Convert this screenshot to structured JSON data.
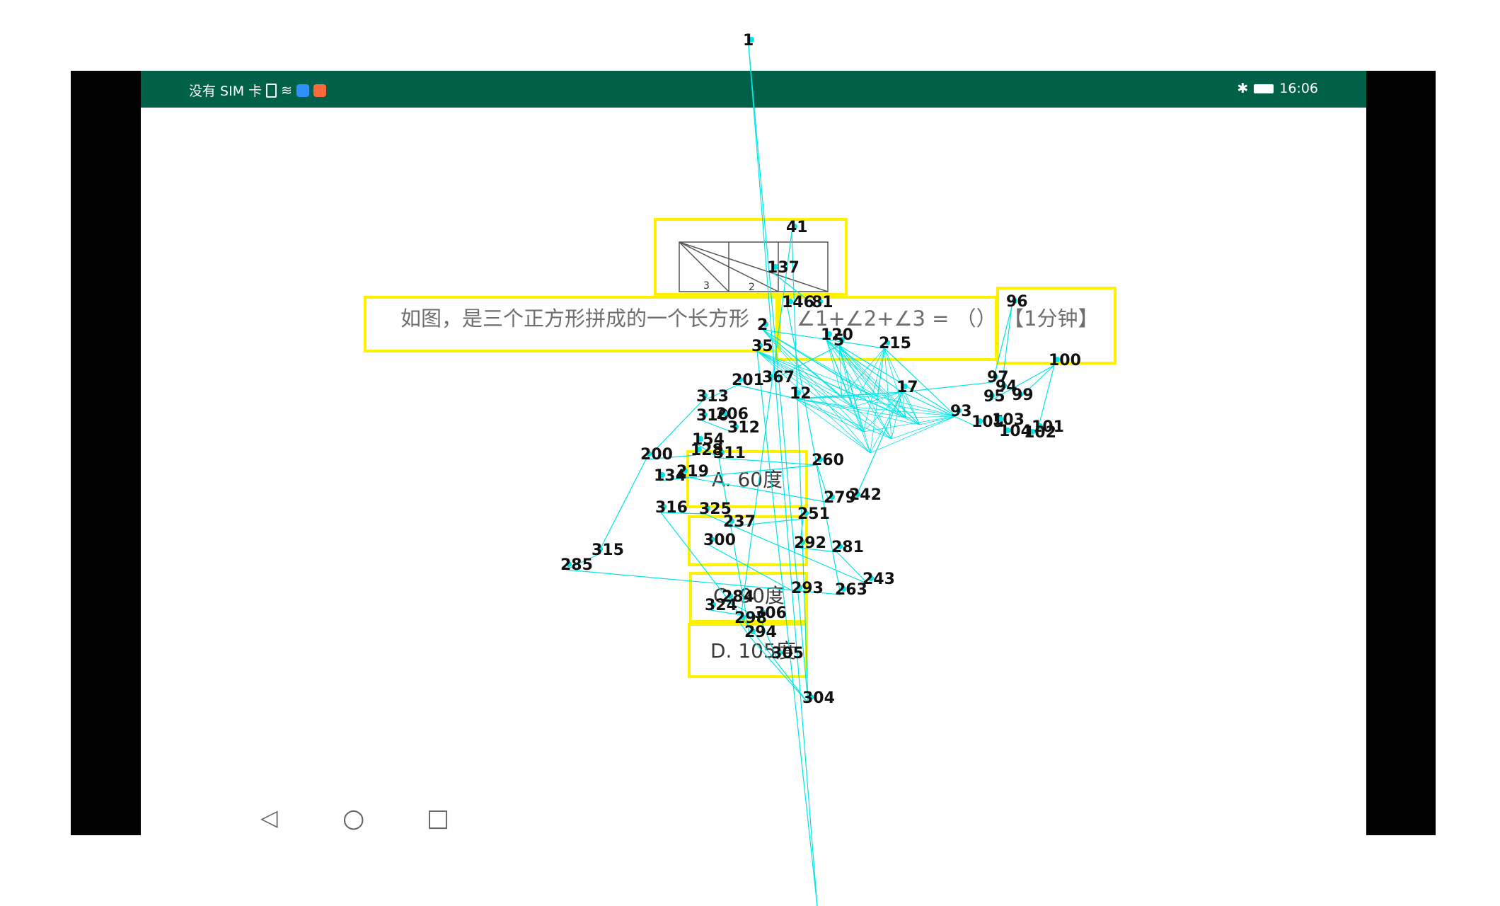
{
  "status_bar": {
    "left_text": "没有 SIM 卡",
    "time": "16:06",
    "bg_color": "#006048"
  },
  "question": {
    "text_part1": "如图，是三个正方形拼成的一个长方形",
    "text_part2": "∠1+∠2+∠3 = （）",
    "time_hint": "【1分钟】",
    "figure_labels": [
      "3",
      "2"
    ]
  },
  "options": {
    "a": "A. 60度",
    "c": "C. 90度",
    "d": "D. 105度"
  },
  "nav": {
    "back": "◁",
    "home": "○",
    "recent": "□"
  },
  "overlay": {
    "line_color": "#00e5e5",
    "box_color": "#fff200",
    "labels": [
      "1",
      "41",
      "137",
      "146",
      "81",
      "96",
      "100",
      "97",
      "94",
      "95",
      "99",
      "93",
      "105",
      "103",
      "104",
      "101",
      "102",
      "313",
      "201",
      "367",
      "12",
      "310",
      "206",
      "312",
      "154",
      "128",
      "311",
      "200",
      "134",
      "219",
      "260",
      "279",
      "242",
      "316",
      "325",
      "237",
      "251",
      "315",
      "285",
      "292",
      "281",
      "243",
      "324",
      "306",
      "298",
      "294",
      "305",
      "304",
      "284",
      "293",
      "263",
      "2",
      "5",
      "35",
      "215",
      "300",
      "17",
      "120"
    ]
  }
}
